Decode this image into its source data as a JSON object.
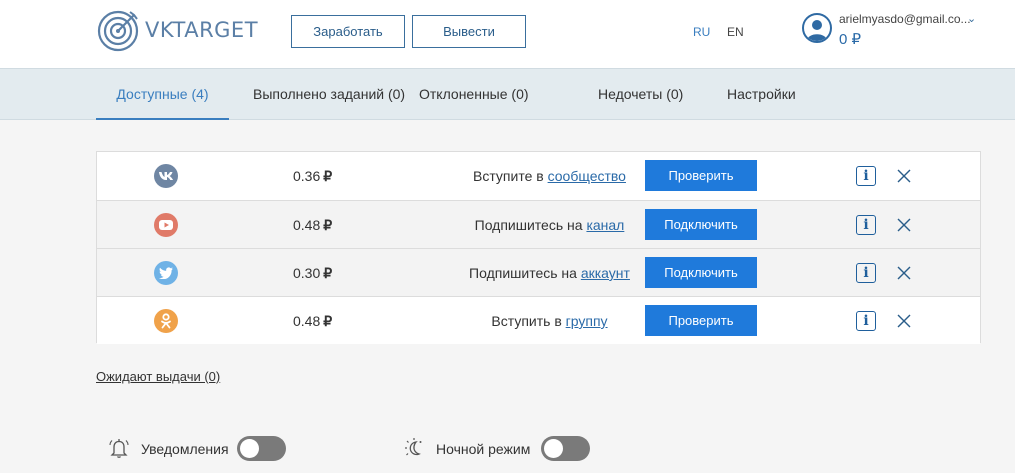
{
  "header": {
    "logo_text": "VKTARGET",
    "earn_label": "Заработать",
    "withdraw_label": "Вывести",
    "lang_ru": "RU",
    "lang_en": "EN",
    "user_email": "arielmyasdo@gmail.co...",
    "balance": "0 ₽"
  },
  "tabs": [
    {
      "label": "Доступные (4)",
      "active": true
    },
    {
      "label": "Выполнено заданий (0)"
    },
    {
      "label": "Отклоненные (0)"
    },
    {
      "label": "Недочеты (0)"
    },
    {
      "label": "Настройки"
    }
  ],
  "tasks": [
    {
      "network": "vk-icon",
      "color": "#6f86a3",
      "price": "0.36",
      "currency": "₽",
      "text": "Вступите в ",
      "link": "сообщество",
      "button": "Проверить"
    },
    {
      "network": "youtube-icon",
      "color": "#e07a68",
      "price": "0.48",
      "currency": "₽",
      "text": "Подпишитесь на ",
      "link": "канал",
      "button": "Подключить"
    },
    {
      "network": "twitter-icon",
      "color": "#6fb2e6",
      "price": "0.30",
      "currency": "₽",
      "text": "Подпишитесь на ",
      "link": "аккаунт",
      "button": "Подключить"
    },
    {
      "network": "odnoklassniki-icon",
      "color": "#f0a24a",
      "price": "0.48",
      "currency": "₽",
      "text": "Вступить в ",
      "link": "группу",
      "button": "Проверить"
    }
  ],
  "info_glyph": "i",
  "waiting_link": "Ожидают выдачи (0)",
  "toggles": {
    "notifications_label": "Уведомления",
    "night_mode_label": "Ночной режим"
  },
  "colors": {
    "accent": "#1f7adb",
    "tab_bg": "#e3ebef",
    "toggle_off": "#7a7a7a"
  }
}
